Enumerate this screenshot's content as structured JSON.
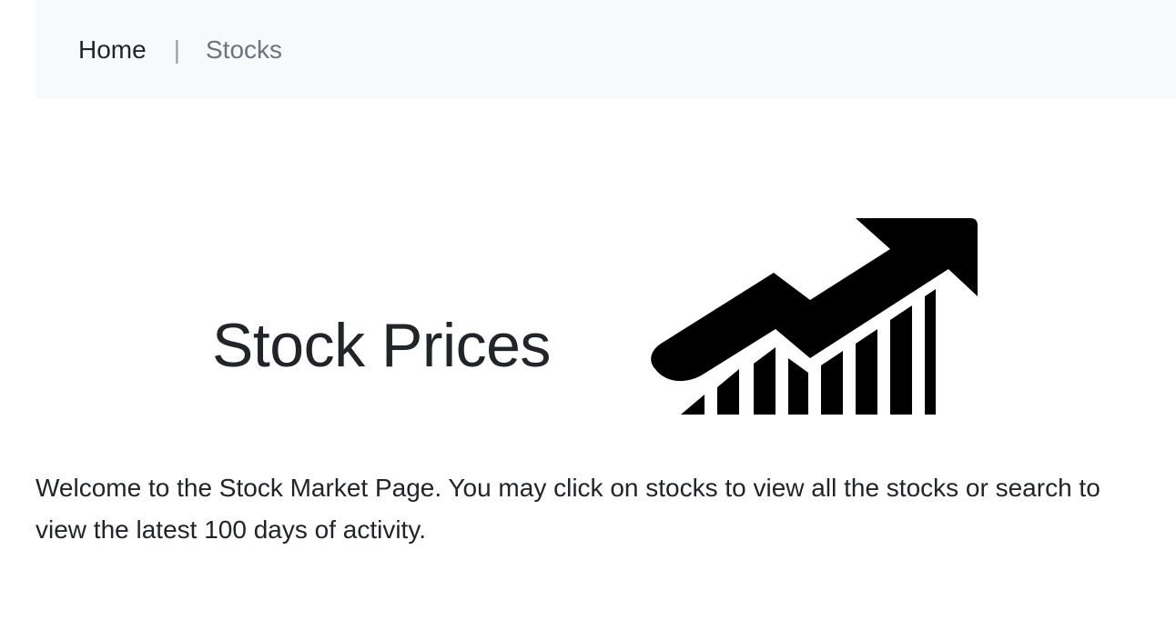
{
  "nav": {
    "home_label": "Home",
    "separator": "|",
    "stocks_label": "Stocks"
  },
  "hero": {
    "title": "Stock Prices",
    "icon": "growth-chart-arrow-icon"
  },
  "intro": {
    "text": "Welcome to the Stock Market Page. You may click on stocks to view all the stocks or search to view the latest 100 days of activity."
  },
  "colors": {
    "navbar_bg": "#f8f9fa",
    "text": "#212529",
    "muted_link": "#6c757d"
  }
}
